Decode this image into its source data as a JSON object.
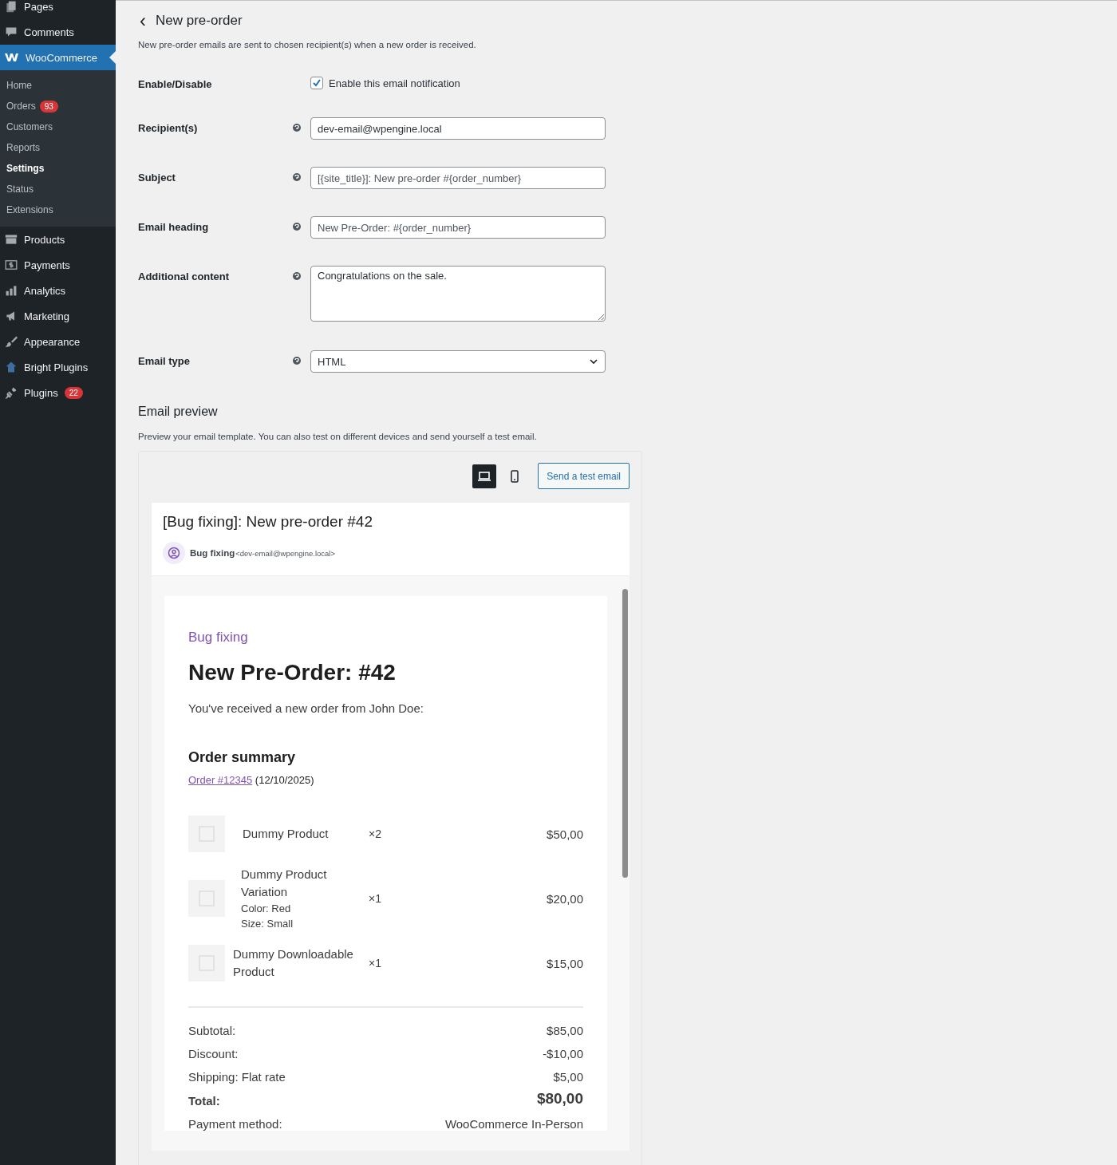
{
  "sidebar": {
    "items": [
      {
        "label": "Pages",
        "current": false
      },
      {
        "label": "Comments",
        "current": false
      },
      {
        "label": "WooCommerce",
        "current": true,
        "children": [
          {
            "label": "Home",
            "selected": false
          },
          {
            "label": "Orders",
            "badge": "93",
            "selected": false
          },
          {
            "label": "Customers",
            "selected": false
          },
          {
            "label": "Reports",
            "selected": false
          },
          {
            "label": "Settings",
            "selected": true
          },
          {
            "label": "Status",
            "selected": false
          },
          {
            "label": "Extensions",
            "selected": false
          }
        ]
      },
      {
        "label": "Products",
        "current": false
      },
      {
        "label": "Payments",
        "current": false
      },
      {
        "label": "Analytics",
        "current": false
      },
      {
        "label": "Marketing",
        "current": false
      },
      {
        "label": "Appearance",
        "current": false
      },
      {
        "label": "Bright Plugins",
        "current": false
      },
      {
        "label": "Plugins",
        "badge": "22",
        "current": false
      }
    ]
  },
  "page": {
    "back": "‹",
    "title": "New pre-order",
    "description": "New pre-order emails are sent to chosen recipient(s) when a new order is received."
  },
  "fields": [
    {
      "kind": "checkbox",
      "label": "Enable/Disable",
      "help": false,
      "text": "Enable this email notification",
      "checked": true
    },
    {
      "kind": "text",
      "label": "Recipient(s)",
      "help": true,
      "value": "dev-email@wpengine.local"
    },
    {
      "kind": "text",
      "label": "Subject",
      "help": true,
      "placeholder": "[{site_title}]: New pre-order #{order_number}"
    },
    {
      "kind": "text",
      "label": "Email heading",
      "help": true,
      "placeholder": "New Pre-Order: #{order_number}"
    },
    {
      "kind": "textarea",
      "label": "Additional content",
      "help": true,
      "value": "Congratulations on the sale."
    },
    {
      "kind": "select",
      "label": "Email type",
      "help": true,
      "value": "HTML"
    }
  ],
  "preview": {
    "title": "Email preview",
    "description": "Preview your email template. You can also test on different devices and send yourself a test email.",
    "devices": [
      {
        "kind": "desktop",
        "selected": true
      },
      {
        "kind": "mobile",
        "selected": false
      }
    ],
    "send_button": "Send a test email",
    "subject": "[Bug fixing]: New pre-order #42",
    "sender_name": "Bug fixing",
    "sender_email": "<dev-email@wpengine.local>",
    "email": {
      "site": "Bug fixing",
      "heading": "New Pre-Order: #42",
      "intro": "You've received a new order from John Doe:",
      "summary_title": "Order summary",
      "order_link": "Order #12345",
      "order_date": "(12/10/2025)",
      "items": [
        {
          "name": "Dummy Product",
          "qty": "×2",
          "price": "$50,00"
        },
        {
          "name": "Dummy Product Variation",
          "meta": [
            "Color: Red",
            "Size: Small"
          ],
          "qty": "×1",
          "price": "$20,00"
        },
        {
          "name": "Dummy Downloadable Product",
          "qty": "×1",
          "price": "$15,00"
        }
      ],
      "totals": [
        {
          "kind": "normal",
          "label": "Subtotal:",
          "value": "$85,00"
        },
        {
          "kind": "normal",
          "label": "Discount:",
          "value": "-$10,00"
        },
        {
          "kind": "normal",
          "label": "Shipping: Flat rate",
          "value": "$5,00"
        },
        {
          "kind": "total",
          "label": "Total:",
          "value": "$80,00"
        },
        {
          "kind": "normal",
          "label": "Payment method:",
          "value": "WooCommerce In-Person"
        }
      ]
    }
  }
}
